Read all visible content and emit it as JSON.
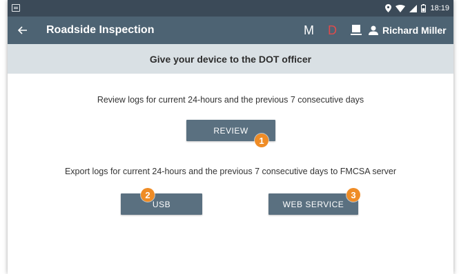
{
  "status_bar": {
    "time": "18:19"
  },
  "app_bar": {
    "title": "Roadside Inspection",
    "status_m": "M",
    "status_d": "D",
    "user_name": "Richard  Miller"
  },
  "banner": {
    "text": "Give your device to the DOT officer"
  },
  "review_section": {
    "text": "Review logs for current 24-hours and the previous 7 consecutive days",
    "button_label": "REVIEW",
    "badge": "1"
  },
  "export_section": {
    "text": "Export logs for current 24-hours and the previous 7 consecutive days to FMCSA server",
    "usb_label": "USB",
    "usb_badge": "2",
    "web_service_label": "WEB SERVICE",
    "web_service_badge": "3"
  },
  "colors": {
    "status_bar": "#3b4a58",
    "app_bar": "#4d6373",
    "banner": "#d9e0e4",
    "button": "#5a7080",
    "badge": "#ef8c26",
    "status_d": "#e04b4b"
  },
  "icons": [
    "screenshot-icon",
    "location-icon",
    "wifi-icon",
    "signal-icon",
    "battery-icon",
    "back-arrow-icon",
    "device-icon",
    "user-icon"
  ]
}
